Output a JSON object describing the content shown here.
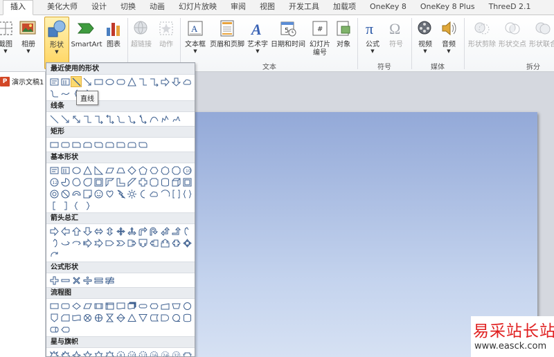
{
  "tabs": [
    {
      "label": "插入",
      "active": true
    },
    {
      "label": "美化大师"
    },
    {
      "label": "设计"
    },
    {
      "label": "切换"
    },
    {
      "label": "动画"
    },
    {
      "label": "幻灯片放映"
    },
    {
      "label": "审阅"
    },
    {
      "label": "视图"
    },
    {
      "label": "开发工具"
    },
    {
      "label": "加载项"
    },
    {
      "label": "OneKey 8"
    },
    {
      "label": "OneKey 8 Plus"
    },
    {
      "label": "ThreeD 2.1"
    }
  ],
  "ribbon": {
    "buttons": {
      "screenshot": "截图",
      "album": "相册",
      "shapes": "形状",
      "smartart": "SmartArt",
      "chart": "图表",
      "hyperlink": "超链接",
      "action": "动作",
      "textbox": "文本框",
      "header_footer": "页眉和页脚",
      "wordart": "艺术字",
      "datetime": "日期和时间",
      "slide_number_1": "幻灯片",
      "slide_number_2": "编号",
      "object": "对象",
      "equation": "公式",
      "symbol": "符号",
      "video": "视频",
      "audio": "音频",
      "shape_subtract": "形状剪除",
      "shape_intersect": "形状交点",
      "shape_union": "形状联合"
    },
    "groups": {
      "text": "文本",
      "symbols": "符号",
      "media": "媒体",
      "split": "拆分"
    }
  },
  "document": {
    "tab_label": "演示文稿1",
    "icon_letter": "P"
  },
  "dropdown": {
    "sections": {
      "recent": "最近使用的形状",
      "lines": "线条",
      "rectangles": "矩形",
      "basic": "基本形状",
      "arrows": "箭头总汇",
      "equation": "公式形状",
      "flowchart": "流程图",
      "stars": "星与旗帜"
    },
    "tooltip": "直线"
  },
  "watermark": {
    "title": "易采站长站",
    "url": "www.easck.com"
  },
  "colors": {
    "accent": "#ffd45e",
    "slide_top": "#93a9d8",
    "slide_bottom": "#d6e1f3",
    "watermark_red": "#e02020"
  }
}
